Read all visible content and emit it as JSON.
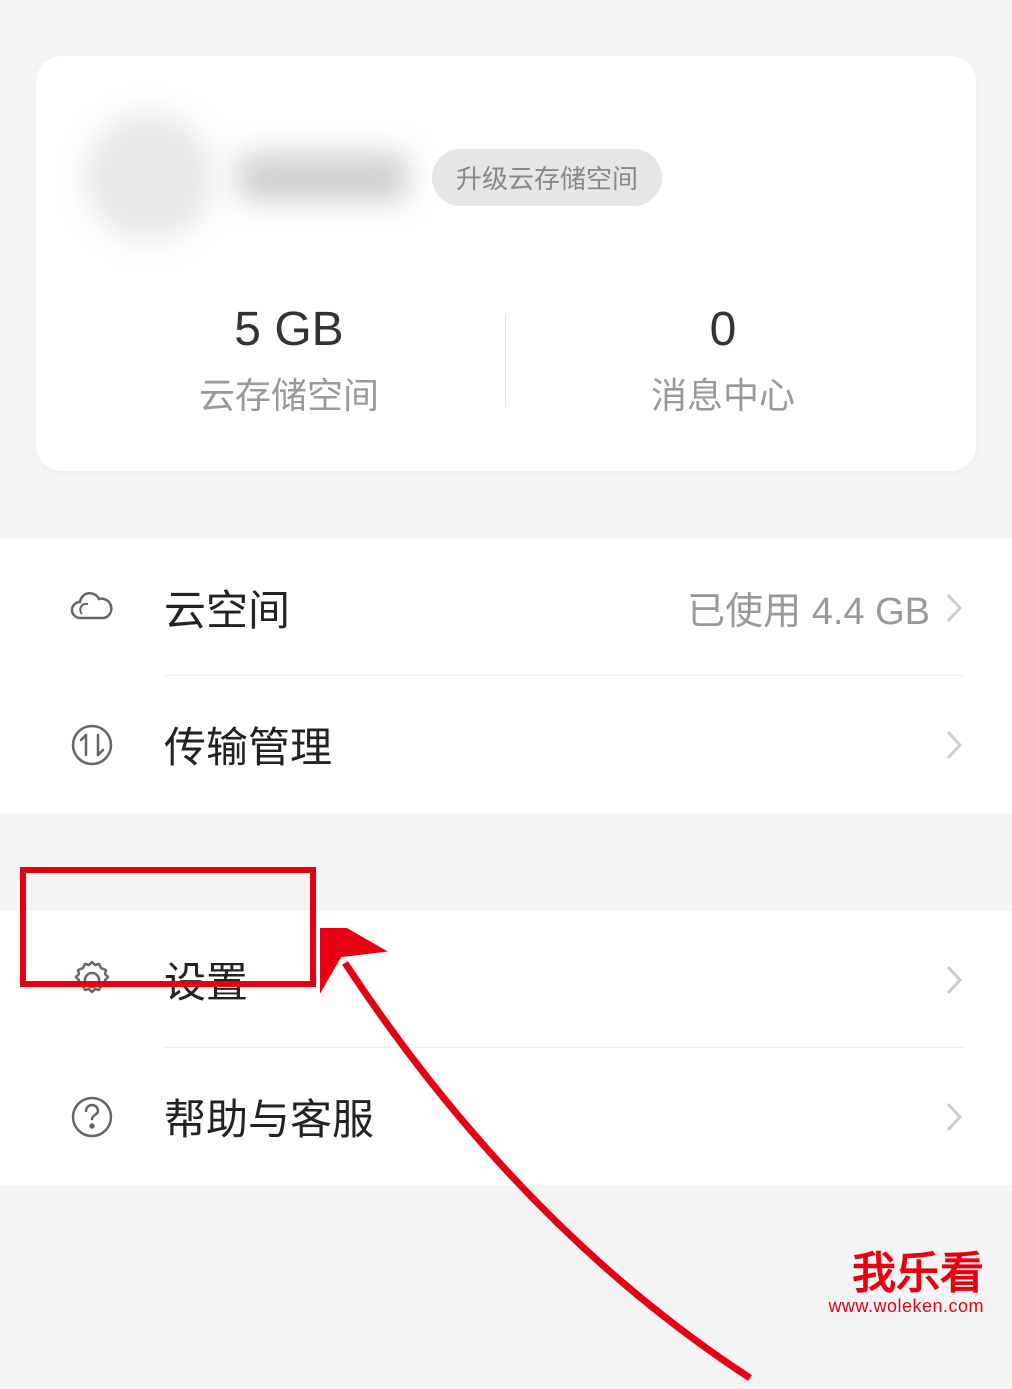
{
  "profile": {
    "upgrade_badge": "升级云存储空间",
    "stats": [
      {
        "value": "5 GB",
        "label": "云存储空间"
      },
      {
        "value": "0",
        "label": "消息中心"
      }
    ]
  },
  "menu_group_1": [
    {
      "icon": "cloud-icon",
      "label": "云空间",
      "value": "已使用 4.4 GB"
    },
    {
      "icon": "transfer-icon",
      "label": "传输管理",
      "value": ""
    }
  ],
  "menu_group_2": [
    {
      "icon": "gear-icon",
      "label": "设置",
      "value": ""
    },
    {
      "icon": "help-icon",
      "label": "帮助与客服",
      "value": ""
    }
  ],
  "watermark": {
    "main": "我乐看",
    "sub": "www.woleken.com"
  }
}
